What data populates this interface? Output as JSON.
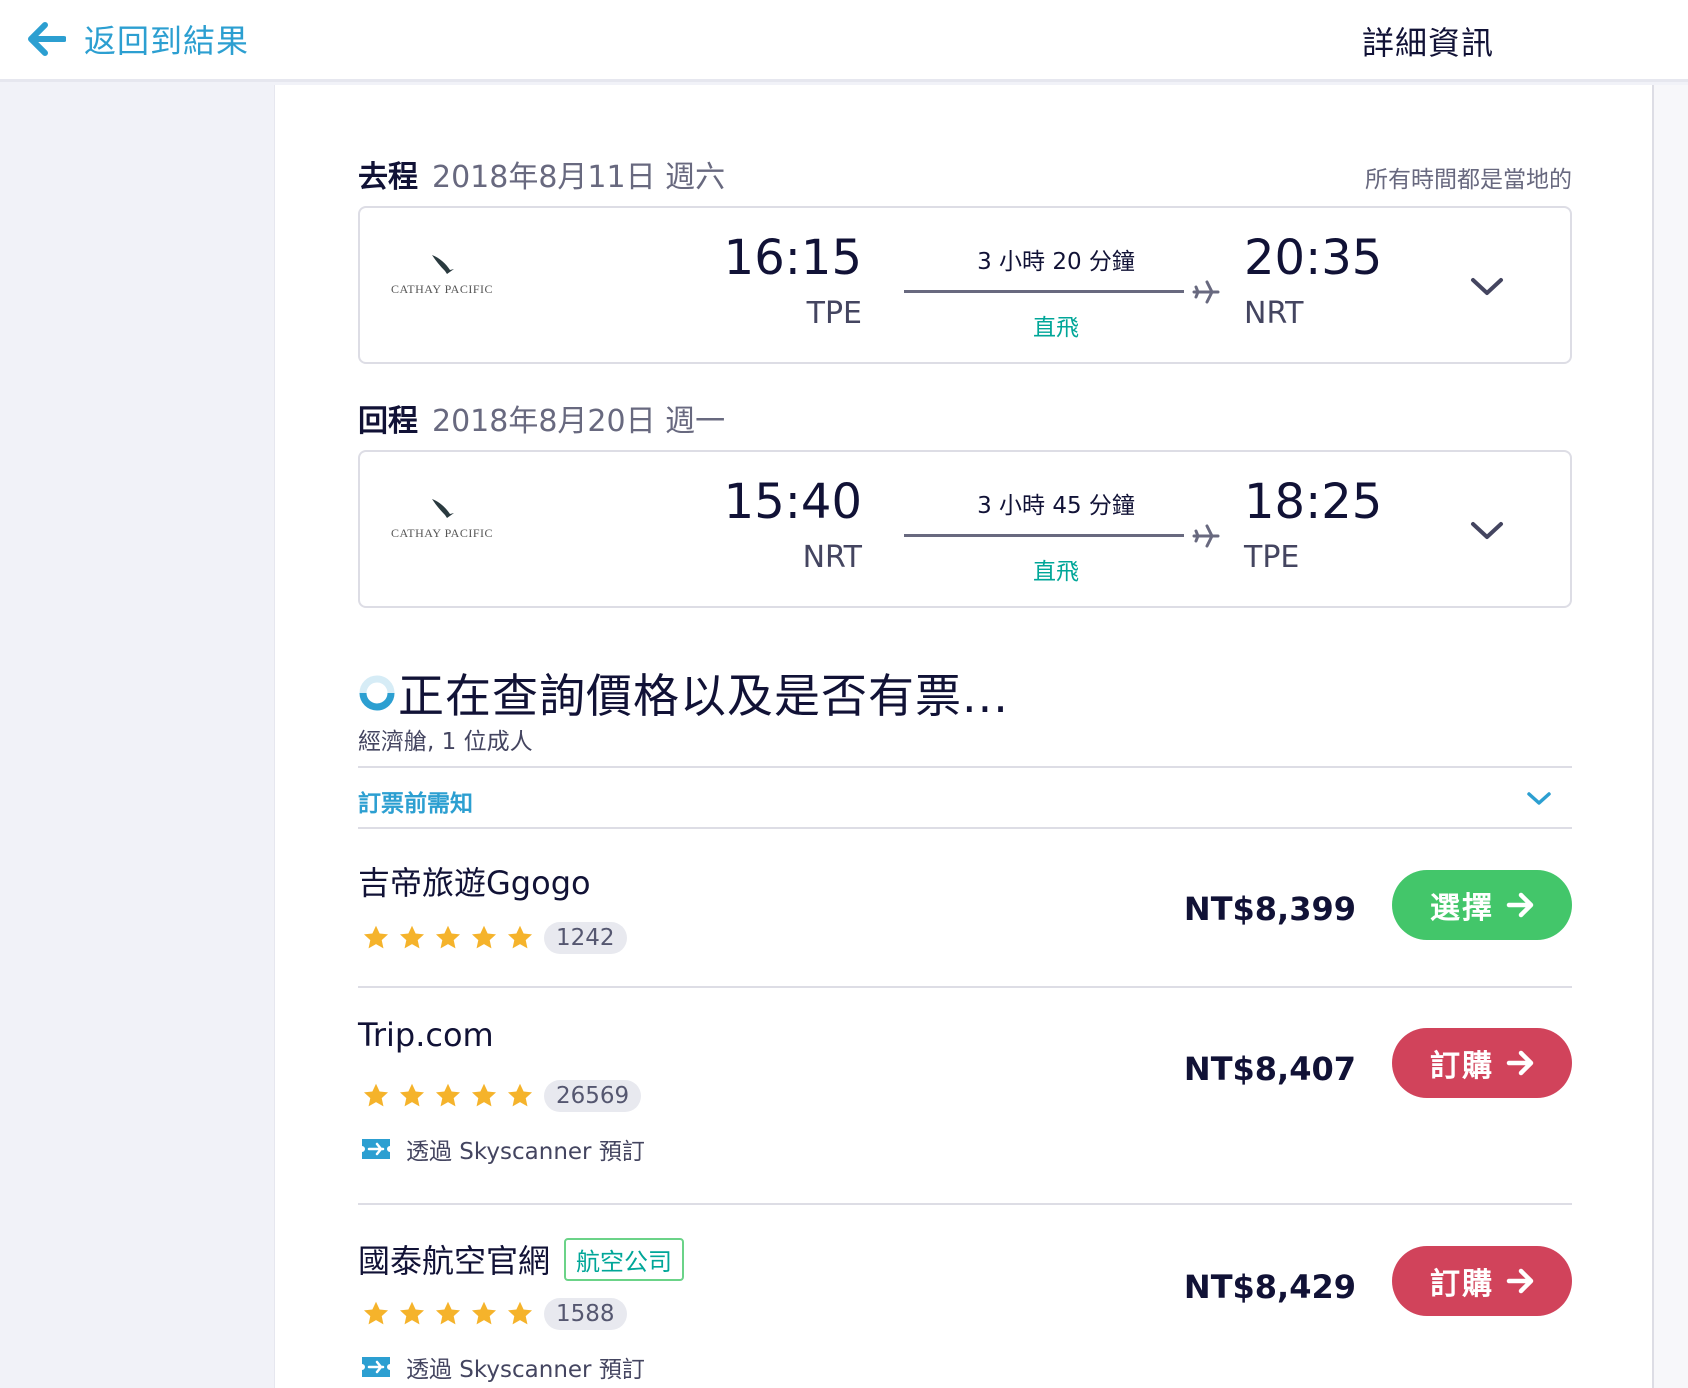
{
  "header": {
    "back_label": "返回到結果",
    "title": "詳細資訊"
  },
  "itinerary": {
    "timezone_note": "所有時間都是當地的",
    "legs": [
      {
        "type": "去程",
        "date": "2018年8月11日 週六",
        "airline": "CATHAY PACIFIC",
        "dep_time": "16:15",
        "dep_code": "TPE",
        "duration": "3 小時 20 分鐘",
        "stops": "直飛",
        "arr_time": "20:35",
        "arr_code": "NRT"
      },
      {
        "type": "回程",
        "date": "2018年8月20日 週一",
        "airline": "CATHAY PACIFIC",
        "dep_time": "15:40",
        "dep_code": "NRT",
        "duration": "3 小時 45 分鐘",
        "stops": "直飛",
        "arr_time": "18:25",
        "arr_code": "TPE"
      }
    ]
  },
  "pricing": {
    "loading_title": "正在查詢價格以及是否有票...",
    "cabin_info": "經濟艙, 1 位成人",
    "notice_label": "訂票前需知",
    "providers": [
      {
        "name": "吉帝旅遊Ggogo",
        "stars": 5,
        "reviews": "1242",
        "price": "NT$8,399",
        "button_label": "選擇",
        "button_color": "#43c66a"
      },
      {
        "name": "Trip.com",
        "stars": 5,
        "reviews": "26569",
        "via": "透過 Skyscanner 預訂",
        "price": "NT$8,407",
        "button_label": "訂購",
        "button_color": "#d1435b"
      },
      {
        "name": "國泰航空官網",
        "badge": "航空公司",
        "stars": 5,
        "reviews": "1588",
        "via": "透過 Skyscanner 預訂",
        "price": "NT$8,429",
        "button_label": "訂購",
        "button_color": "#d1435b"
      }
    ]
  },
  "colors": {
    "accent_blue": "#2c9fd1",
    "direct_green": "#00a698",
    "select_green": "#43c66a",
    "book_pink": "#d1435b",
    "star": "#f5b32b"
  },
  "icons": [
    "arrow-left-icon",
    "airline-logo-icon",
    "plane-icon",
    "chevron-down-icon",
    "spinner-icon",
    "star-icon",
    "ticket-icon",
    "arrow-right-icon"
  ]
}
